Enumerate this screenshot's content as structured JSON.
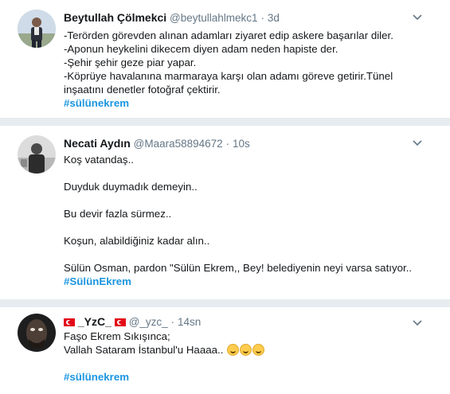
{
  "tweets": [
    {
      "name": "Beytullah Çölmekci",
      "handle": "@beytullahlmekc1",
      "dot": "·",
      "time": "3d",
      "lines": [
        "-Terörden görevden alınan adamları ziyaret edip askere başarılar diler.",
        "-Aponun heykelini dikecem diyen adam neden hapiste der.",
        "-Şehir şehir geze piar yapar.",
        "-Köprüye havalanına marmaraya karşı olan adamı göreve getirir.Tünel",
        "inşaatını denetler fotoğraf çektirir."
      ],
      "hashtag": "#sülünekrem"
    },
    {
      "name": "Necati Aydın",
      "handle": "@Maara58894672",
      "dot": "·",
      "time": "10s",
      "lines": [
        "Koş vatandaş..",
        "Duyduk duymadık demeyin..",
        "Bu devir fazla sürmez..",
        "Koşun, alabildiğiniz kadar alın..",
        "Sülün Osman, pardon \"Sülün Ekrem,, Bey! belediyenin neyi varsa satıyor.."
      ],
      "hashtag": "#SülünEkrem"
    },
    {
      "name": "_YzC_",
      "handle": "@_yzc_",
      "dot": "·",
      "time": "14sn",
      "lines": [
        "Faşo Ekrem Sıkışınca;",
        "Vallah Sataram İstanbul'u Haaaa.."
      ],
      "hashtag": "#sülünekrem"
    }
  ],
  "icons": {
    "menu": "chevron-down-icon",
    "flag": "turkey-flag-icon",
    "emoji": "laughing-tears-emoji"
  },
  "colors": {
    "link": "#1b95e0",
    "muted": "#657786",
    "divider": "#e6ecf0"
  }
}
